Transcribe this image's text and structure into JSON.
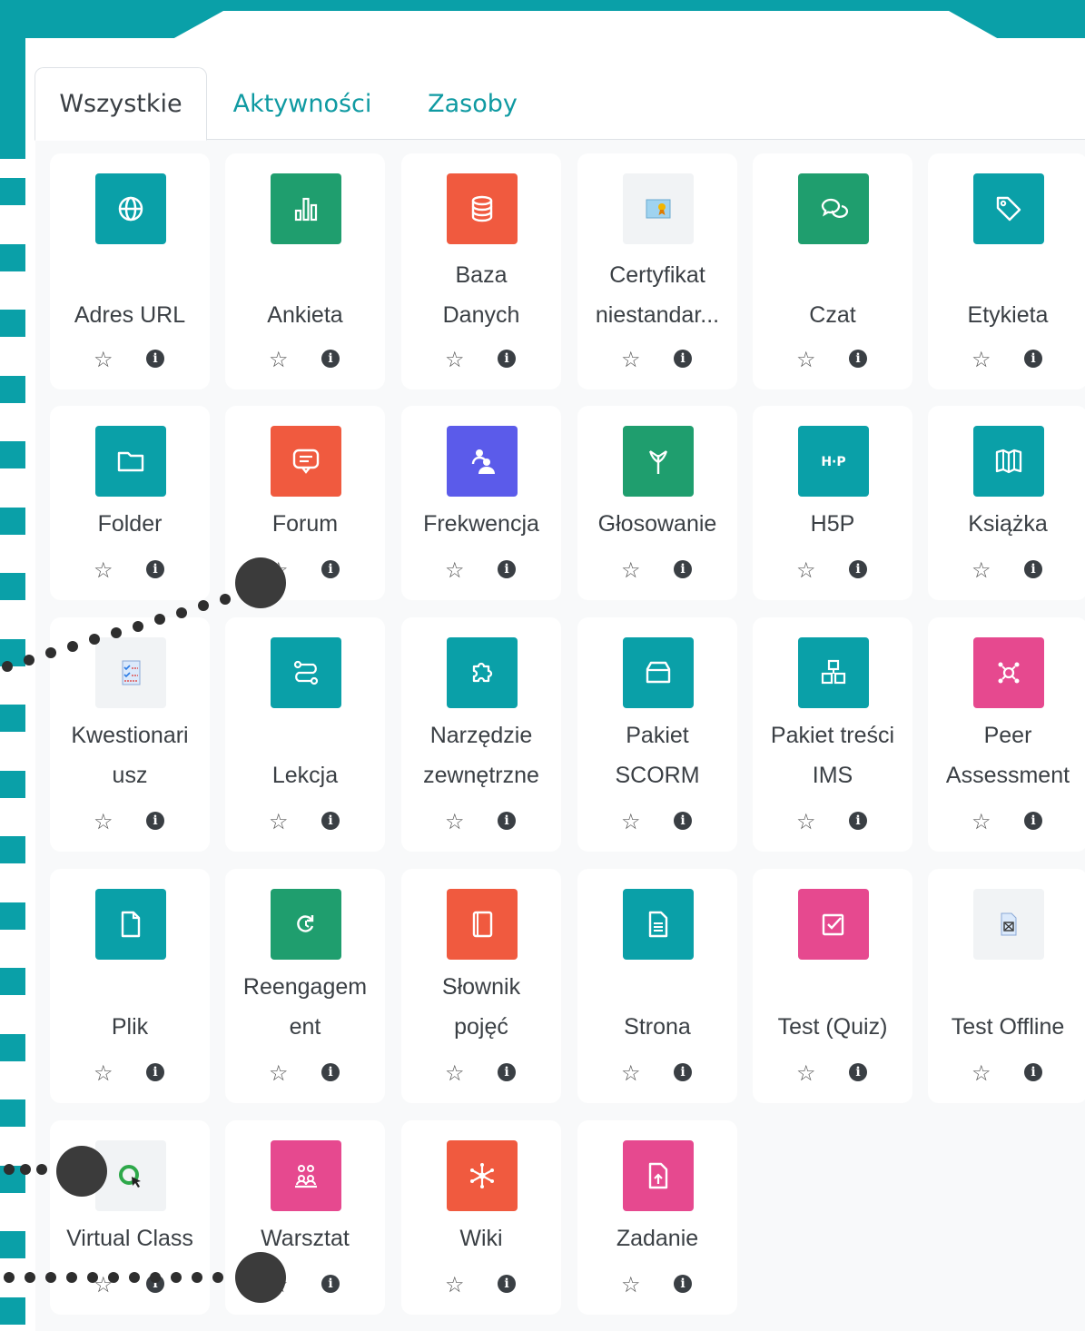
{
  "colors": {
    "teal": "#0aa0a8",
    "green": "#1f9e6e",
    "orange": "#f05a3f",
    "purple": "#5b5bea",
    "pink": "#e6498f",
    "light": "#f1f3f5",
    "tab_active_text": "#3a3f44",
    "tab_link": "#0f9aa2"
  },
  "tabs": [
    {
      "label": "Wszystkie"
    },
    {
      "label": "Aktywności"
    },
    {
      "label": "Zasoby"
    }
  ],
  "modules": [
    {
      "lines": [
        "Adres URL"
      ],
      "icon": "globe-icon",
      "color": "teal"
    },
    {
      "lines": [
        "Ankieta"
      ],
      "icon": "bar-chart-icon",
      "color": "green"
    },
    {
      "lines": [
        "Baza",
        "Danych"
      ],
      "icon": "database-icon",
      "color": "orange"
    },
    {
      "lines": [
        "Certyfikat",
        "niestandar..."
      ],
      "icon": "certificate-icon",
      "color": "light"
    },
    {
      "lines": [
        "Czat"
      ],
      "icon": "chat-bubbles-icon",
      "color": "green"
    },
    {
      "lines": [
        "Etykieta"
      ],
      "icon": "tag-icon",
      "color": "teal"
    },
    {
      "lines": [
        "Folder"
      ],
      "icon": "folder-icon",
      "color": "teal"
    },
    {
      "lines": [
        "Forum"
      ],
      "icon": "forum-icon",
      "color": "orange"
    },
    {
      "lines": [
        "Frekwencja"
      ],
      "icon": "attendance-icon",
      "color": "purple"
    },
    {
      "lines": [
        "Głosowanie"
      ],
      "icon": "signpost-icon",
      "color": "green"
    },
    {
      "lines": [
        "H5P"
      ],
      "icon": "h5p-icon",
      "color": "teal"
    },
    {
      "lines": [
        "Książka"
      ],
      "icon": "book-icon",
      "color": "teal"
    },
    {
      "lines": [
        "Kwestionari",
        "usz"
      ],
      "icon": "questionnaire-icon",
      "color": "light"
    },
    {
      "lines": [
        "Lekcja"
      ],
      "icon": "lesson-path-icon",
      "color": "teal"
    },
    {
      "lines": [
        "Narzędzie",
        "zewnętrzne"
      ],
      "icon": "puzzle-icon",
      "color": "teal"
    },
    {
      "lines": [
        "Pakiet",
        "SCORM"
      ],
      "icon": "package-icon",
      "color": "teal"
    },
    {
      "lines": [
        "Pakiet treści",
        "IMS"
      ],
      "icon": "boxes-icon",
      "color": "teal"
    },
    {
      "lines": [
        "Peer",
        "Assessment"
      ],
      "icon": "peer-assessment-icon",
      "color": "pink"
    },
    {
      "lines": [
        "Plik"
      ],
      "icon": "file-icon",
      "color": "teal"
    },
    {
      "lines": [
        "Reengagem",
        "ent"
      ],
      "icon": "reengagement-icon",
      "color": "green"
    },
    {
      "lines": [
        "Słownik",
        "pojęć"
      ],
      "icon": "glossary-icon",
      "color": "orange"
    },
    {
      "lines": [
        "Strona"
      ],
      "icon": "page-icon",
      "color": "teal"
    },
    {
      "lines": [
        "Test (Quiz)"
      ],
      "icon": "quiz-check-icon",
      "color": "pink"
    },
    {
      "lines": [
        "Test Offline"
      ],
      "icon": "offline-quiz-icon",
      "color": "light"
    },
    {
      "lines": [
        "Virtual Class"
      ],
      "icon": "virtual-class-icon",
      "color": "light"
    },
    {
      "lines": [
        "Warsztat"
      ],
      "icon": "workshop-icon",
      "color": "pink"
    },
    {
      "lines": [
        "Wiki"
      ],
      "icon": "wiki-icon",
      "color": "orange"
    },
    {
      "lines": [
        "Zadanie"
      ],
      "icon": "assignment-icon",
      "color": "pink"
    }
  ],
  "star_glyph": "☆",
  "info_glyph": "i"
}
